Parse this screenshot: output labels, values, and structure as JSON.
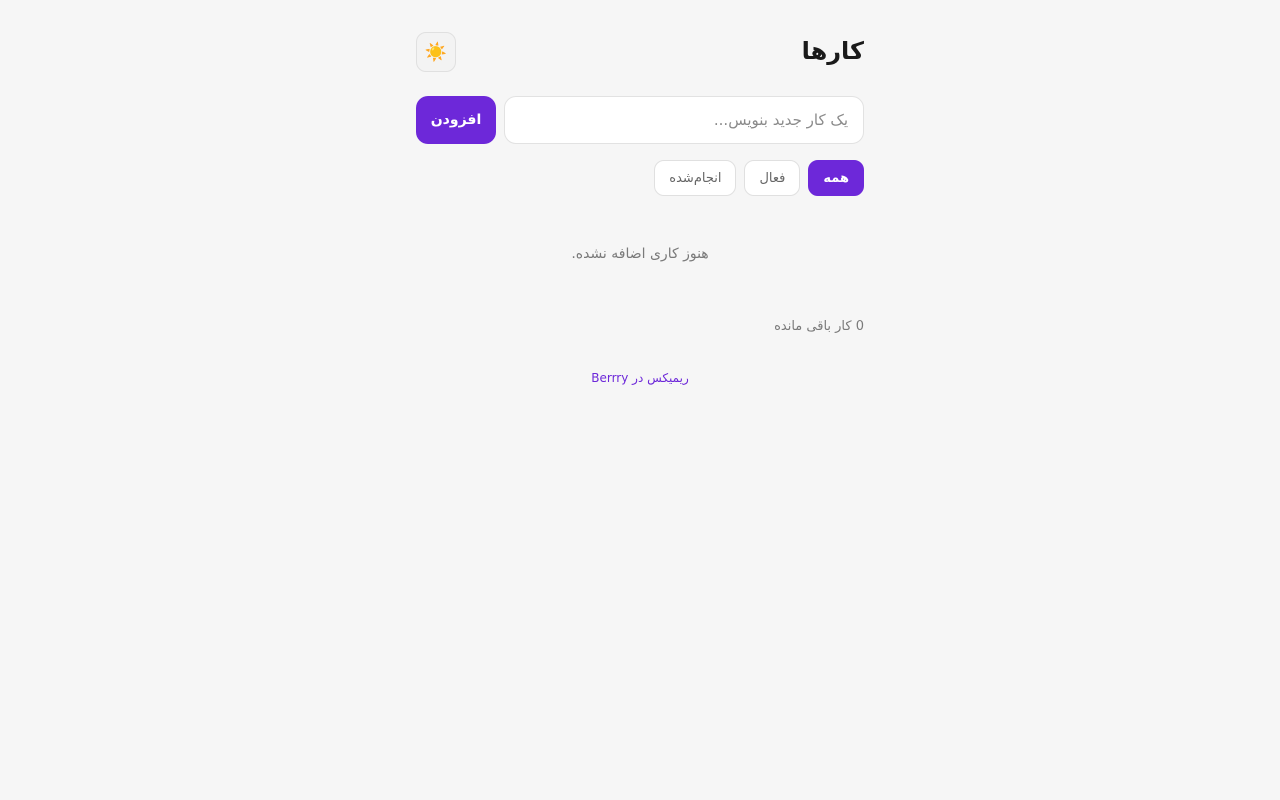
{
  "header": {
    "title": "کارها",
    "theme_toggle_icon": "sun-icon",
    "theme_toggle_glyph": "☀️"
  },
  "composer": {
    "input_value": "",
    "input_placeholder": "یک کار جدید بنویس...",
    "add_label": "افزودن"
  },
  "filters": {
    "selected": "all",
    "items": [
      {
        "id": "all",
        "label": "همه"
      },
      {
        "id": "active",
        "label": "فعال"
      },
      {
        "id": "done",
        "label": "انجام‌شده"
      }
    ]
  },
  "list": {
    "empty_message": "هنوز کاری اضافه نشده."
  },
  "status": {
    "remaining_text": "0 کار باقی مانده"
  },
  "footer": {
    "remix_link": "ریمیکس در Berrry"
  },
  "colors": {
    "accent": "#6d28d9",
    "background": "#f6f6f6",
    "muted_text": "#7a7a7a"
  }
}
